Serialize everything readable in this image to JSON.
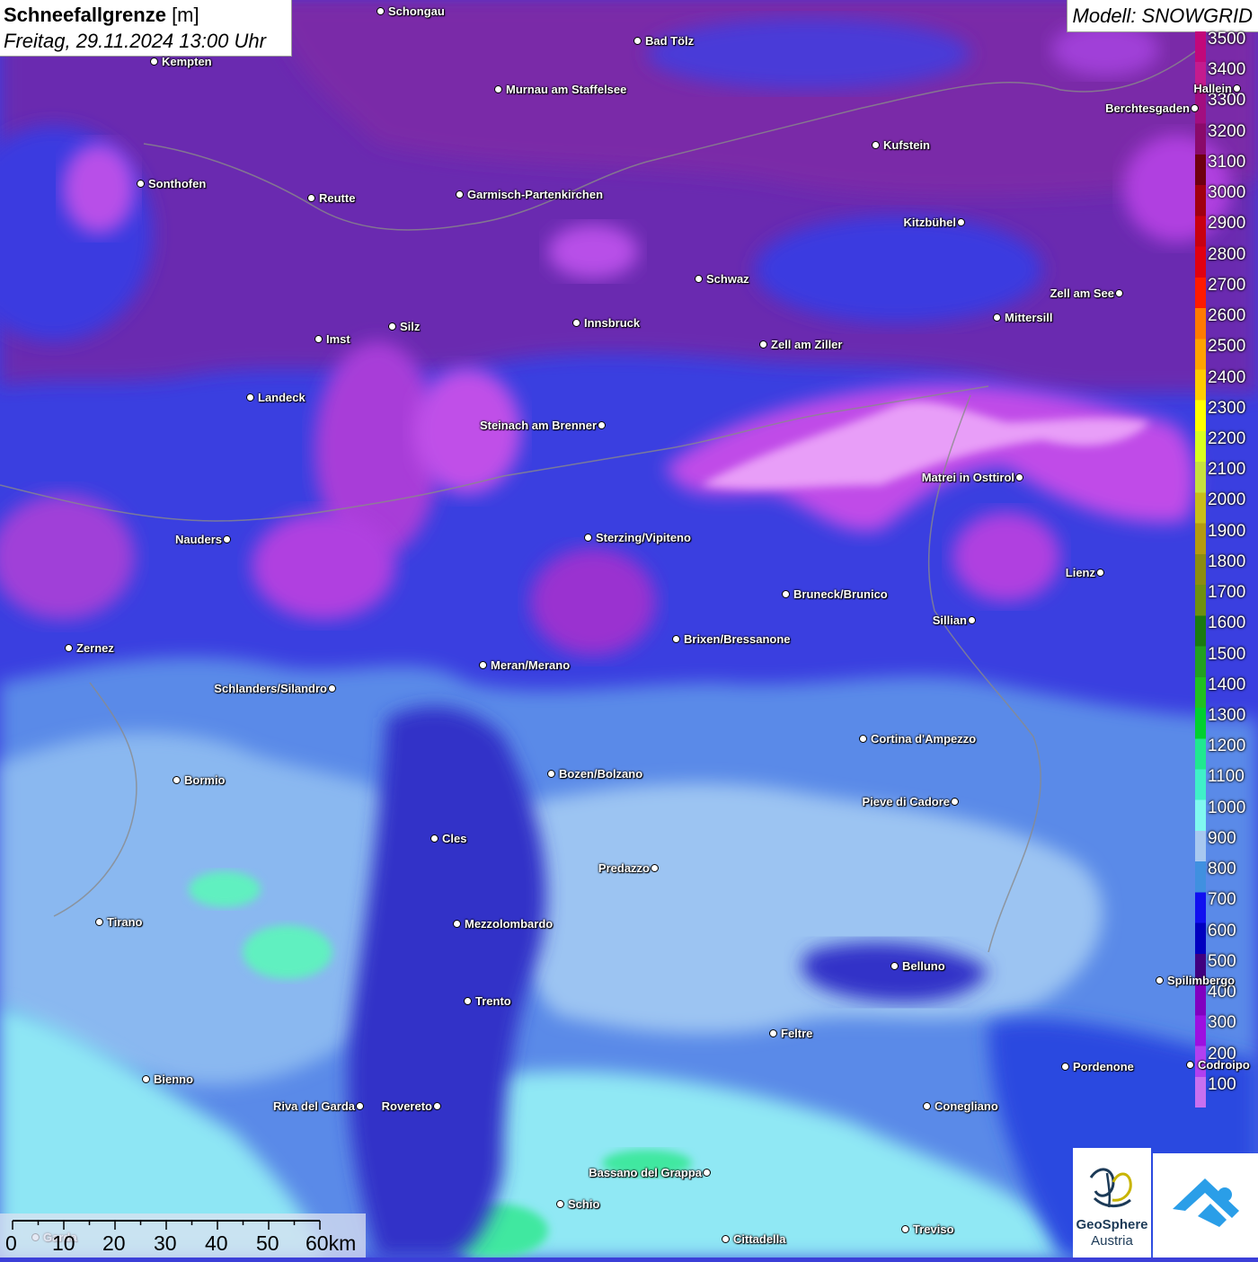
{
  "header": {
    "title_bold": "Schneefallgrenze",
    "title_unit": " [m]",
    "datetime": "Freitag, 29.11.2024 13:00 Uhr"
  },
  "model_label": "Modell: SNOWGRID",
  "legend": {
    "labels": [
      "3500",
      "3400",
      "3300",
      "3200",
      "3100",
      "3000",
      "2900",
      "2800",
      "2700",
      "2600",
      "2500",
      "2400",
      "2300",
      "2200",
      "2100",
      "2000",
      "1900",
      "1800",
      "1700",
      "1600",
      "1500",
      "1400",
      "1300",
      "1200",
      "1100",
      "1000",
      "900",
      "800",
      "700",
      "600",
      "500",
      "400",
      "300",
      "200",
      "100"
    ],
    "colors": [
      "#c2087a",
      "#c41b8e",
      "#a20e80",
      "#8a0a6a",
      "#6e0010",
      "#a00010",
      "#c80010",
      "#e00010",
      "#ff1a00",
      "#ff7a00",
      "#ffa200",
      "#ffcc00",
      "#ffff00",
      "#d8ff20",
      "#c6e040",
      "#c8bd1a",
      "#b49a10",
      "#8c8c10",
      "#6e9010",
      "#1a7a10",
      "#22a020",
      "#20c020",
      "#00d030",
      "#20e890",
      "#40f0c8",
      "#80f8f0",
      "#a8c8f0",
      "#4090e0",
      "#1010f0",
      "#0000c0",
      "#400080",
      "#8000c0",
      "#9c10e0",
      "#b040f0",
      "#c870f0"
    ]
  },
  "cities": [
    {
      "name": "Schongau"
    },
    {
      "name": "Bad Tölz"
    },
    {
      "name": "Kempten"
    },
    {
      "name": "Murnau am Staffelsee"
    },
    {
      "name": "Hallein"
    },
    {
      "name": "Berchtesgaden"
    },
    {
      "name": "Kufstein"
    },
    {
      "name": "Sonthofen"
    },
    {
      "name": "Reutte"
    },
    {
      "name": "Garmisch-Partenkirchen"
    },
    {
      "name": "Kitzbühel"
    },
    {
      "name": "Schwaz"
    },
    {
      "name": "Zell am See"
    },
    {
      "name": "Innsbruck"
    },
    {
      "name": "Mittersill"
    },
    {
      "name": "Imst"
    },
    {
      "name": "Silz"
    },
    {
      "name": "Zell am Ziller"
    },
    {
      "name": "Landeck"
    },
    {
      "name": "Steinach am Brenner"
    },
    {
      "name": "Matrei in Osttirol"
    },
    {
      "name": "Nauders"
    },
    {
      "name": "Sterzing/Vipiteno"
    },
    {
      "name": "Lienz"
    },
    {
      "name": "Bruneck/Brunico"
    },
    {
      "name": "Sillian"
    },
    {
      "name": "Zernez"
    },
    {
      "name": "Brixen/Bressanone"
    },
    {
      "name": "Meran/Merano"
    },
    {
      "name": "Schlanders/Silandro"
    },
    {
      "name": "Cortina d'Ampezzo"
    },
    {
      "name": "Bozen/Bolzano"
    },
    {
      "name": "Bormio"
    },
    {
      "name": "Pieve di Cadore"
    },
    {
      "name": "Cles"
    },
    {
      "name": "Predazzo"
    },
    {
      "name": "Tirano"
    },
    {
      "name": "Mezzolombardo"
    },
    {
      "name": "Belluno"
    },
    {
      "name": "Spilimbergo"
    },
    {
      "name": "Trento"
    },
    {
      "name": "Feltre"
    },
    {
      "name": "Pordenone"
    },
    {
      "name": "Codroipo"
    },
    {
      "name": "Bienno"
    },
    {
      "name": "Riva del Garda"
    },
    {
      "name": "Rovereto"
    },
    {
      "name": "Conegliano"
    },
    {
      "name": "Bassano del Grappa"
    },
    {
      "name": "Schio"
    },
    {
      "name": "Treviso"
    },
    {
      "name": "Cittadella"
    },
    {
      "name": "Garda"
    }
  ],
  "scale": {
    "labels": [
      "0",
      "10",
      "20",
      "30",
      "40",
      "50",
      "60km"
    ]
  },
  "logos": {
    "geosphere_name": "GeoSphere",
    "geosphere_sub": "Austria"
  }
}
